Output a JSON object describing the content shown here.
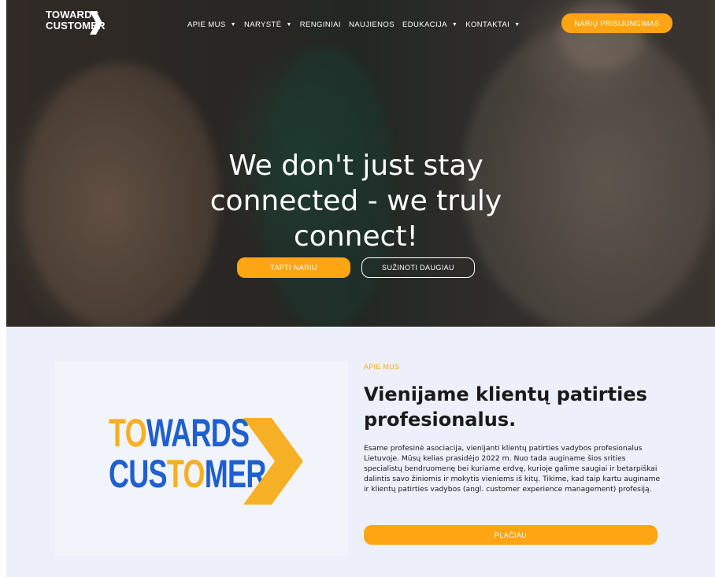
{
  "brand": {
    "logo_line1": "TOWARDS",
    "logo_line2": "CUSTOMER",
    "accent": "#ffa514",
    "logo_yellow": "#f5b026",
    "logo_blue": "#1f5fce"
  },
  "nav": {
    "items": [
      {
        "label": "APIE MUS",
        "has_dropdown": true
      },
      {
        "label": "NARYSTĖ",
        "has_dropdown": true
      },
      {
        "label": "RENGINIAI",
        "has_dropdown": false
      },
      {
        "label": "NAUJIENOS",
        "has_dropdown": false
      },
      {
        "label": "EDUKACIJA",
        "has_dropdown": true
      },
      {
        "label": "KONTAKTAI",
        "has_dropdown": true
      }
    ],
    "login_label": "NARIŲ PRISIJUNGIMAS",
    "caret_icon": "chevron-down-icon"
  },
  "hero": {
    "title": "We don't just stay connected - we truly connect!",
    "primary_label": "TAPTI NARIU",
    "secondary_label": "SUŽINOTI DAUGIAU"
  },
  "about": {
    "eyebrow": "APIE MUS",
    "title": "Vienijame klientų patirties profesionalus.",
    "body": "Esame profesinė asociacija, vienijanti klientų patirties vadybos profesionalus Lietuvoje. Mūsų kelias prasidėjo 2022 m. Nuo tada auginame šios srities specialistų bendruomenę bei kuriame erdvę, kurioje galime saugiai ir betarpiškai dalintis savo žiniomis ir mokytis vieniems iš kitų. Tikime, kad taip kartu auginame ir klientų patirties vadybos (angl. customer experience management) profesiją.",
    "button_label": "PLAČIAU",
    "logo_parts": {
      "row1_a": "TO",
      "row1_b": "WARDS",
      "row2_a": "CUS",
      "row2_b": "TO",
      "row2_c": "MER"
    }
  }
}
